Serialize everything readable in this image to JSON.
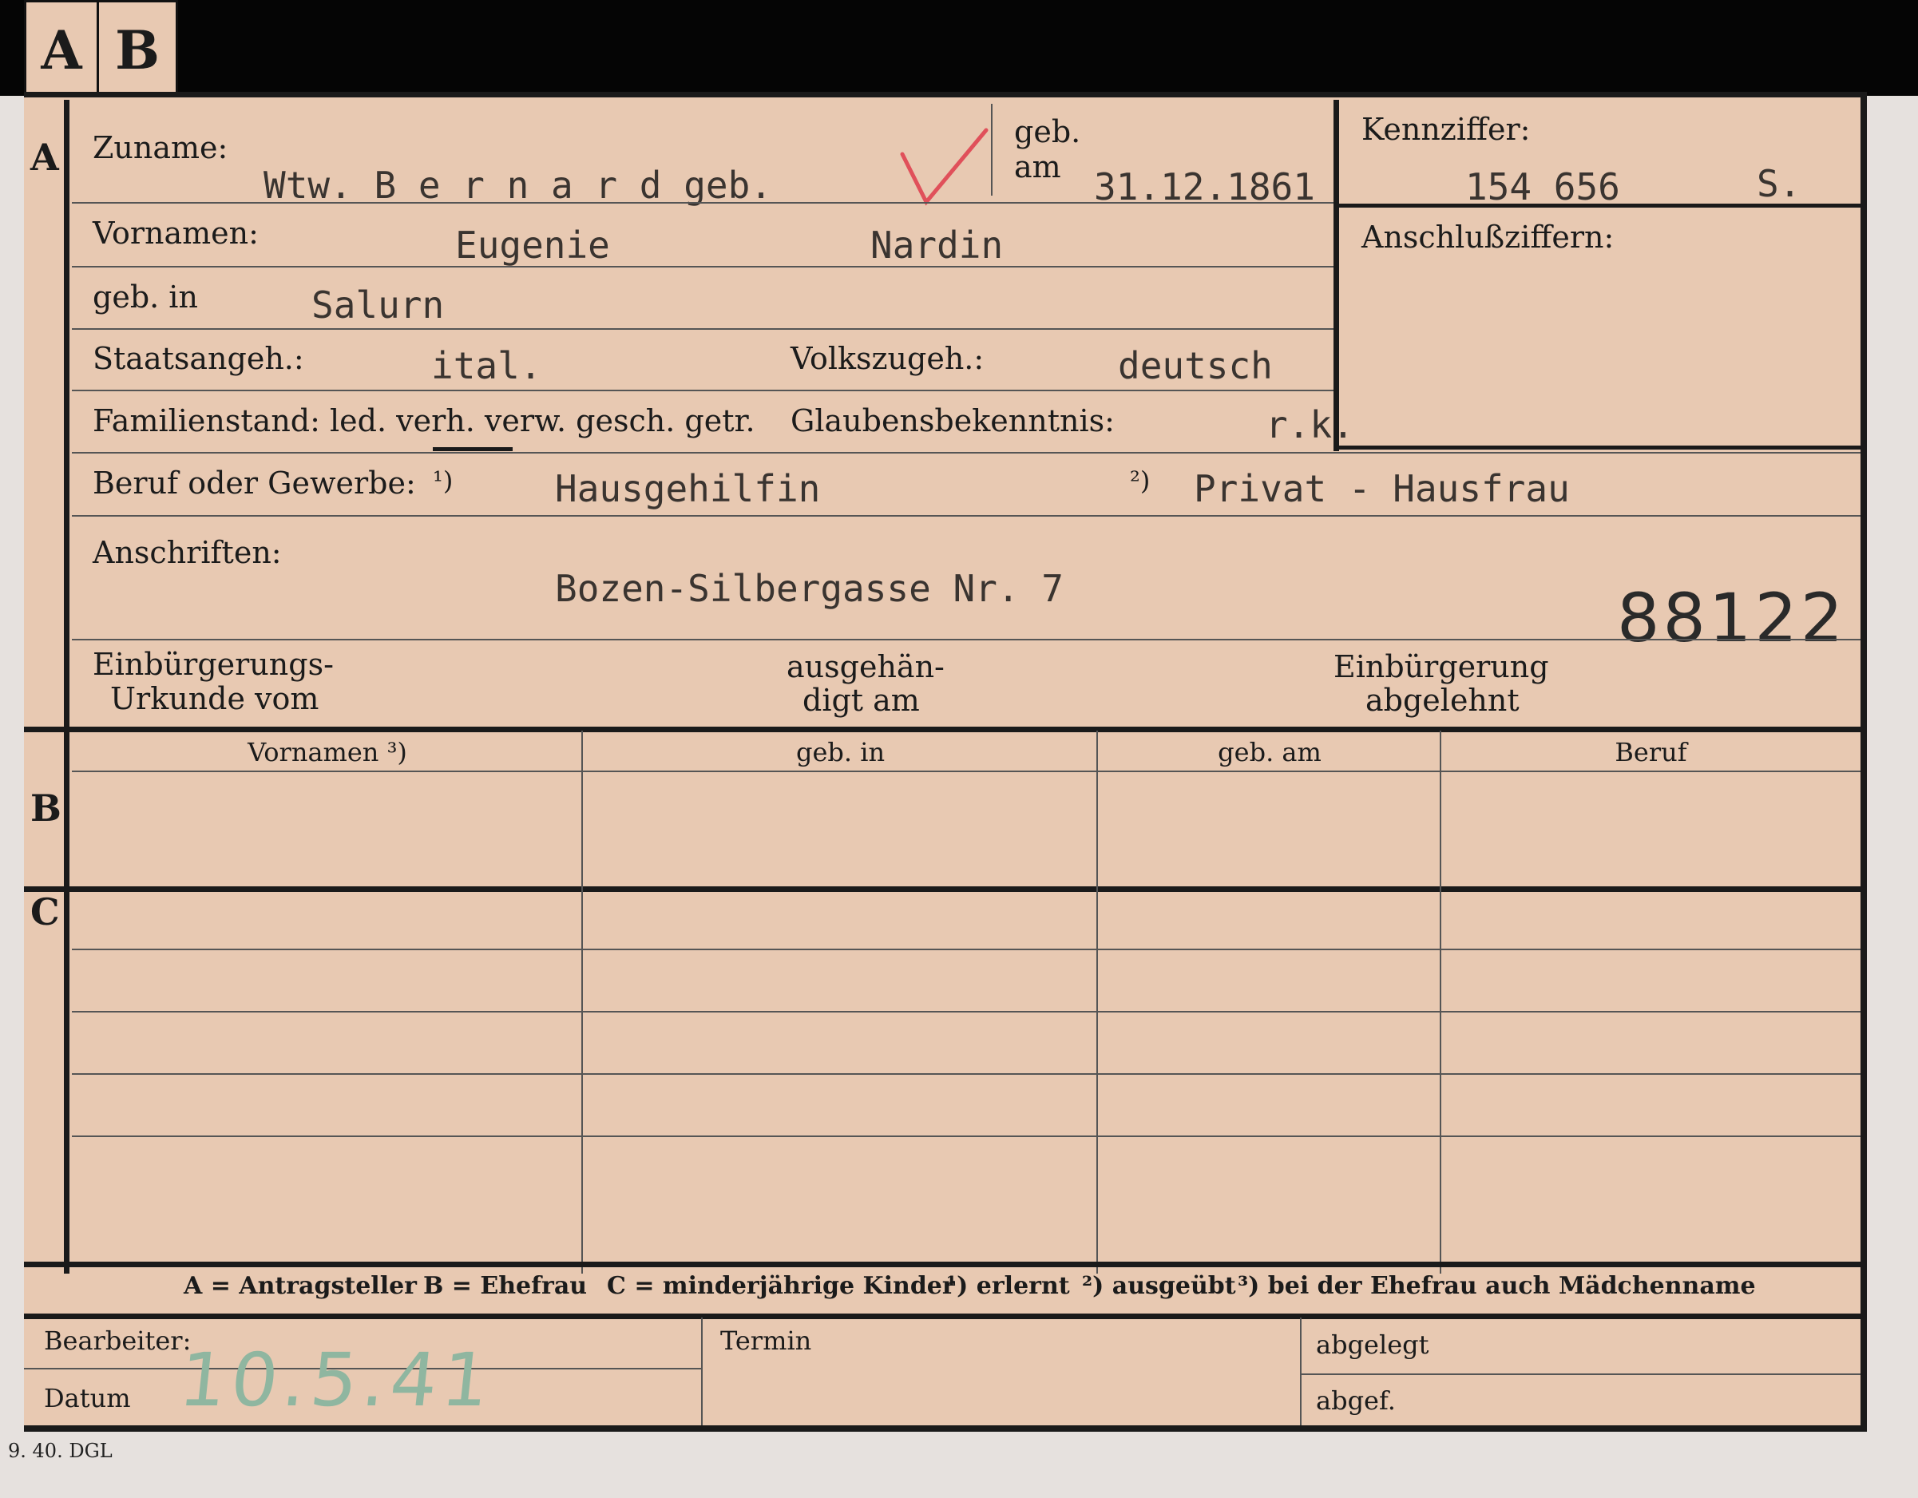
{
  "tabs": [
    "A",
    "B"
  ],
  "sections": {
    "a": "A",
    "b": "B",
    "c": "C"
  },
  "header": {
    "zuname_label": "Zuname:",
    "zuname_value": "Wtw. B e r n a r d   geb.",
    "geb_am_label_1": "geb.",
    "geb_am_label_2": "am",
    "geb_am_value": "31.12.1861",
    "kennziffer_label": "Kennziffer:",
    "kennziffer_value": "154 656",
    "kennziffer_suffix": "S.",
    "anschluss_label": "Anschlußziffern:",
    "check_color": "#e0505a"
  },
  "rows": {
    "vornamen_label": "Vornamen:",
    "vornamen_1": "Eugenie",
    "vornamen_2": "Nardin",
    "gebin_label": "geb. in",
    "gebin_value": "Salurn",
    "staat_label": "Staatsangeh.:",
    "staat_value": "ital.",
    "volk_label": "Volkszugeh.:",
    "volk_value": "deutsch",
    "familien_label": "Familienstand: led. verh. verw. gesch. getr.",
    "glauben_label": "Glaubensbekenntnis:",
    "glauben_value": "r.k.",
    "beruf_label": "Beruf oder Gewerbe:",
    "beruf_mark_1": "¹)",
    "beruf_value_1": "Hausgehilfin",
    "beruf_mark_2": "²)",
    "beruf_value_2": "Privat - Hausfrau",
    "anschriften_label": "Anschriften:",
    "anschriften_value": "Bozen-Silbergasse Nr. 7",
    "stamp_number": "88122",
    "einb_label_1": "Einbürgerungs-",
    "einb_label_2": "Urkunde vom",
    "ausgeh_label_1": "ausgehän-",
    "ausgeh_label_2": "digt am",
    "abgelehnt_label_1": "Einbürgerung",
    "abgelehnt_label_2": "abgelehnt"
  },
  "table": {
    "headers": [
      "Vornamen ³)",
      "geb. in",
      "geb. am",
      "Beruf"
    ]
  },
  "legend": {
    "a": "A = Antragsteller",
    "b": "B = Ehefrau",
    "c": "C = minderjährige Kinder",
    "n1": "¹) erlernt",
    "n2": "²) ausgeübt",
    "n3": "³) bei der Ehefrau auch Mädchenname"
  },
  "footer": {
    "bearbeiter_label": "Bearbeiter:",
    "datum_label": "Datum",
    "datum_value": "10.5.41",
    "termin_label": "Termin",
    "abgelegt_label": "abgelegt",
    "abgef_label": "abgef."
  },
  "printer_mark": "9. 40. DGL"
}
